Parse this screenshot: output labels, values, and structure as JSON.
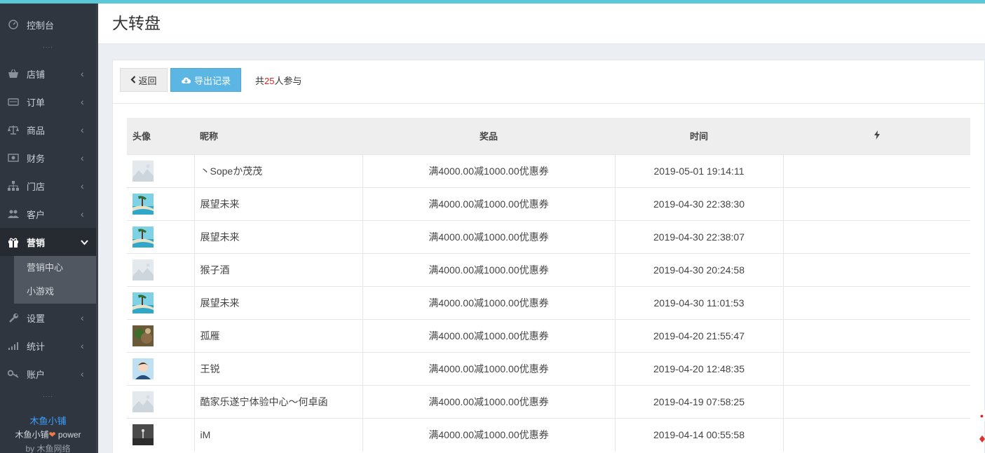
{
  "sidebar": {
    "dashboard": "控制台",
    "items": [
      {
        "label": "店铺",
        "icon": "basket-icon"
      },
      {
        "label": "订单",
        "icon": "order-icon"
      },
      {
        "label": "商品",
        "icon": "scale-icon"
      },
      {
        "label": "财务",
        "icon": "money-icon"
      },
      {
        "label": "门店",
        "icon": "sitemap-icon"
      },
      {
        "label": "客户",
        "icon": "users-icon"
      },
      {
        "label": "营销",
        "icon": "gift-icon"
      },
      {
        "label": "设置",
        "icon": "wrench-icon"
      },
      {
        "label": "统计",
        "icon": "bar-chart-icon"
      },
      {
        "label": "账户",
        "icon": "key-icon"
      }
    ],
    "submenu": [
      "营销中心",
      "小游戏"
    ],
    "brand": {
      "name": "木鱼小铺",
      "power_prefix": "木鱼小铺",
      "power_suffix": " power",
      "by_prefix": "by ",
      "by_company": "木鱼网络"
    }
  },
  "header": {
    "title": "大转盘"
  },
  "toolbar": {
    "back_label": "返回",
    "export_label": "导出记录",
    "count_prefix": "共",
    "count_number": "25",
    "count_suffix": "人参与"
  },
  "table": {
    "headers": [
      "头像",
      "昵称",
      "奖品",
      "时间"
    ],
    "rows": [
      {
        "avatar": "placeholder",
        "nickname": "丶Sopeか茂茂",
        "prize": "满4000.00减1000.00优惠券",
        "time": "2019-05-01 19:14:11"
      },
      {
        "avatar": "beach",
        "nickname": "展望未来",
        "prize": "满4000.00减1000.00优惠券",
        "time": "2019-04-30 22:38:30"
      },
      {
        "avatar": "beach",
        "nickname": "展望未来",
        "prize": "满4000.00减1000.00优惠券",
        "time": "2019-04-30 22:38:07"
      },
      {
        "avatar": "placeholder",
        "nickname": "猴子酒",
        "prize": "满4000.00减1000.00优惠券",
        "time": "2019-04-30 20:24:58"
      },
      {
        "avatar": "beach",
        "nickname": "展望未来",
        "prize": "满4000.00减1000.00优惠券",
        "time": "2019-04-30 11:01:53"
      },
      {
        "avatar": "tea",
        "nickname": "孤雁",
        "prize": "满4000.00减1000.00优惠券",
        "time": "2019-04-20 21:55:47"
      },
      {
        "avatar": "cartoon",
        "nickname": "王锐",
        "prize": "满4000.00减1000.00优惠券",
        "time": "2019-04-20 12:48:35"
      },
      {
        "avatar": "placeholder",
        "nickname": "酷家乐遂宁体验中心～何卓函",
        "prize": "满4000.00减1000.00优惠券",
        "time": "2019-04-19 07:58:25"
      },
      {
        "avatar": "dark",
        "nickname": "iM",
        "prize": "满4000.00减1000.00优惠券",
        "time": "2019-04-14 00:55:58"
      }
    ]
  },
  "colors": {
    "accent": "#5bc8d9",
    "export_button": "#5cb6e4",
    "count_number": "#e02020",
    "brand": "#3aa0ff"
  }
}
